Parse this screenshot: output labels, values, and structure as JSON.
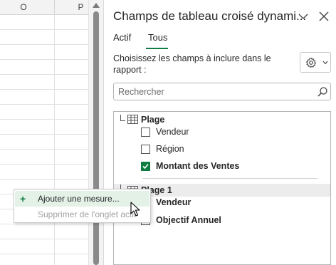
{
  "spreadsheet": {
    "columns": [
      {
        "label": "O"
      },
      {
        "label": "P"
      }
    ]
  },
  "pane": {
    "title": "Champs de tableau croisé dynami...",
    "tabs": [
      {
        "label": "Actif",
        "active": false
      },
      {
        "label": "Tous",
        "active": true
      }
    ],
    "choose_label": "Choisissez les champs à inclure dans le rapport :",
    "search": {
      "placeholder": "Rechercher",
      "value": ""
    },
    "groups": [
      {
        "name": "Plage",
        "expanded": true,
        "fields": [
          {
            "label": "Vendeur",
            "checked": false
          },
          {
            "label": "Région",
            "checked": false
          },
          {
            "label": "Montant des Ventes",
            "checked": true
          }
        ]
      },
      {
        "name": "Plage 1",
        "expanded": true,
        "fields": [
          {
            "label": "Vendeur",
            "checked": false
          },
          {
            "label": "Objectif Annuel",
            "checked": false
          }
        ]
      }
    ]
  },
  "context_menu": {
    "items": [
      {
        "label": "Ajouter une mesure...",
        "icon": "plus-icon",
        "enabled": true,
        "highlighted": true
      },
      {
        "label": "Supprimer de l'onglet actif",
        "enabled": false
      }
    ]
  },
  "colors": {
    "accent": "#107c41",
    "menu_highlight": "#e3f1e7"
  }
}
